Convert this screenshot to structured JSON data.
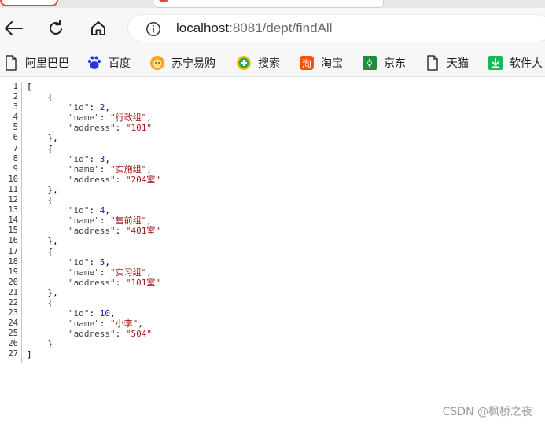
{
  "browser": {
    "url_host": "localhost",
    "url_rest": ":8081/dept/findAll"
  },
  "bookmarks": [
    {
      "label": "阿里巴巴",
      "icon": "document-icon"
    },
    {
      "label": "百度",
      "icon": "baidu-paw-icon"
    },
    {
      "label": "苏宁易购",
      "icon": "suning-lion-icon"
    },
    {
      "label": "搜索",
      "icon": "search-plus-icon"
    },
    {
      "label": "淘宝",
      "icon": "taobao-icon"
    },
    {
      "label": "京东",
      "icon": "jd-icon"
    },
    {
      "label": "天猫",
      "icon": "document-icon"
    },
    {
      "label": "软件大",
      "icon": "download-icon"
    }
  ],
  "json_lines": [
    [
      "1",
      "["
    ],
    [
      "2",
      "    {"
    ],
    [
      "3",
      "        \"id\": 2,"
    ],
    [
      "4",
      "        \"name\": \"行政组\","
    ],
    [
      "5",
      "        \"address\": \"101\""
    ],
    [
      "6",
      "    },"
    ],
    [
      "7",
      "    {"
    ],
    [
      "8",
      "        \"id\": 3,"
    ],
    [
      "9",
      "        \"name\": \"实施组\","
    ],
    [
      "10",
      "        \"address\": \"204室\""
    ],
    [
      "11",
      "    },"
    ],
    [
      "12",
      "    {"
    ],
    [
      "13",
      "        \"id\": 4,"
    ],
    [
      "14",
      "        \"name\": \"售前组\","
    ],
    [
      "15",
      "        \"address\": \"401室\""
    ],
    [
      "16",
      "    },"
    ],
    [
      "17",
      "    {"
    ],
    [
      "18",
      "        \"id\": 5,"
    ],
    [
      "19",
      "        \"name\": \"实习组\","
    ],
    [
      "20",
      "        \"address\": \"101室\""
    ],
    [
      "21",
      "    },"
    ],
    [
      "22",
      "    {"
    ],
    [
      "23",
      "        \"id\": 10,"
    ],
    [
      "24",
      "        \"name\": \"小李\","
    ],
    [
      "25",
      "        \"address\": \"504\""
    ],
    [
      "26",
      "    }"
    ],
    [
      "27",
      "]"
    ]
  ],
  "watermark": "CSDN @枫桥之夜",
  "colors": {
    "string": "#a31515",
    "number": "#1a1aa6",
    "key": "#444444"
  }
}
